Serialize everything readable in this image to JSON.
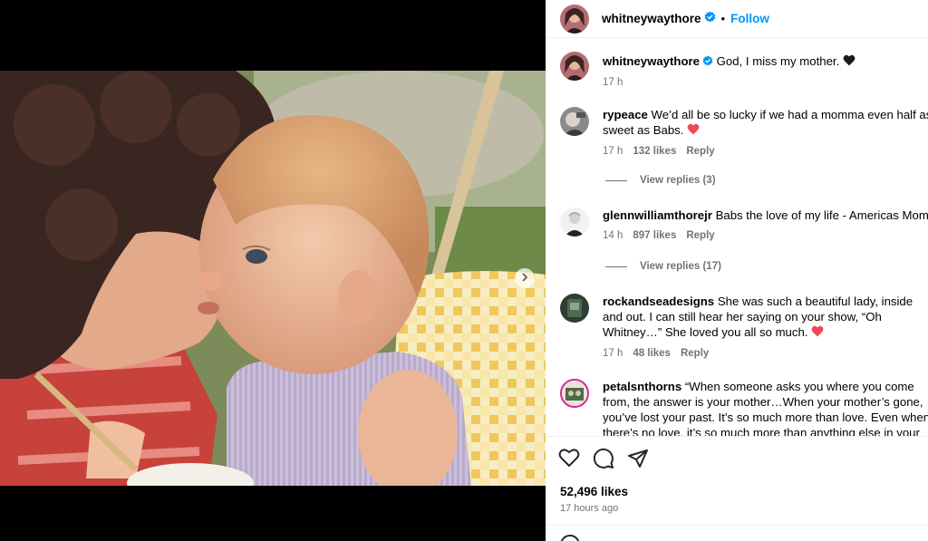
{
  "post": {
    "username": "whitneywaythore",
    "follow_label": "Follow",
    "separator": "•",
    "caption": "God, I miss my mother.",
    "caption_time": "17 h",
    "likes": "52,496 likes",
    "time_ago": "17 hours ago"
  },
  "comments": [
    {
      "username": "rypeace",
      "text": "We’d all be so lucky if we had a momma even half as sweet as Babs.",
      "has_heart": true,
      "time": "17 h",
      "likes": "132 likes",
      "reply": "Reply",
      "view_replies": "View replies (3)"
    },
    {
      "username": "glennwilliamthorejr",
      "text": "Babs the love of my life - Americas Mom!",
      "has_heart": false,
      "time": "14 h",
      "likes": "897 likes",
      "reply": "Reply",
      "view_replies": "View replies (17)"
    },
    {
      "username": "rockandseadesigns",
      "text": "She was such a beautiful lady, inside and out. I can still hear her saying on your show, “Oh Whitney…” She loved you all so much.",
      "has_heart": true,
      "time": "17 h",
      "likes": "48 likes",
      "reply": "Reply"
    },
    {
      "username": "petalsnthorns",
      "text": "“When someone asks you where you come from, the answer is your mother…When your mother’s gone, you’ve lost your past. It’s so much more than love. Even when there’s no love, it’s so much more than anything else in your"
    }
  ],
  "colors": {
    "link_blue": "#0095f6",
    "verified_blue": "#0095f6",
    "heart_red": "#ed4956",
    "muted_text": "#737373"
  },
  "icons": [
    "verified-badge-icon",
    "black-heart-icon",
    "red-heart-icon",
    "like-icon",
    "comment-icon",
    "share-icon",
    "carousel-next-icon"
  ],
  "carousel": {
    "slides": 4,
    "active": 1
  }
}
